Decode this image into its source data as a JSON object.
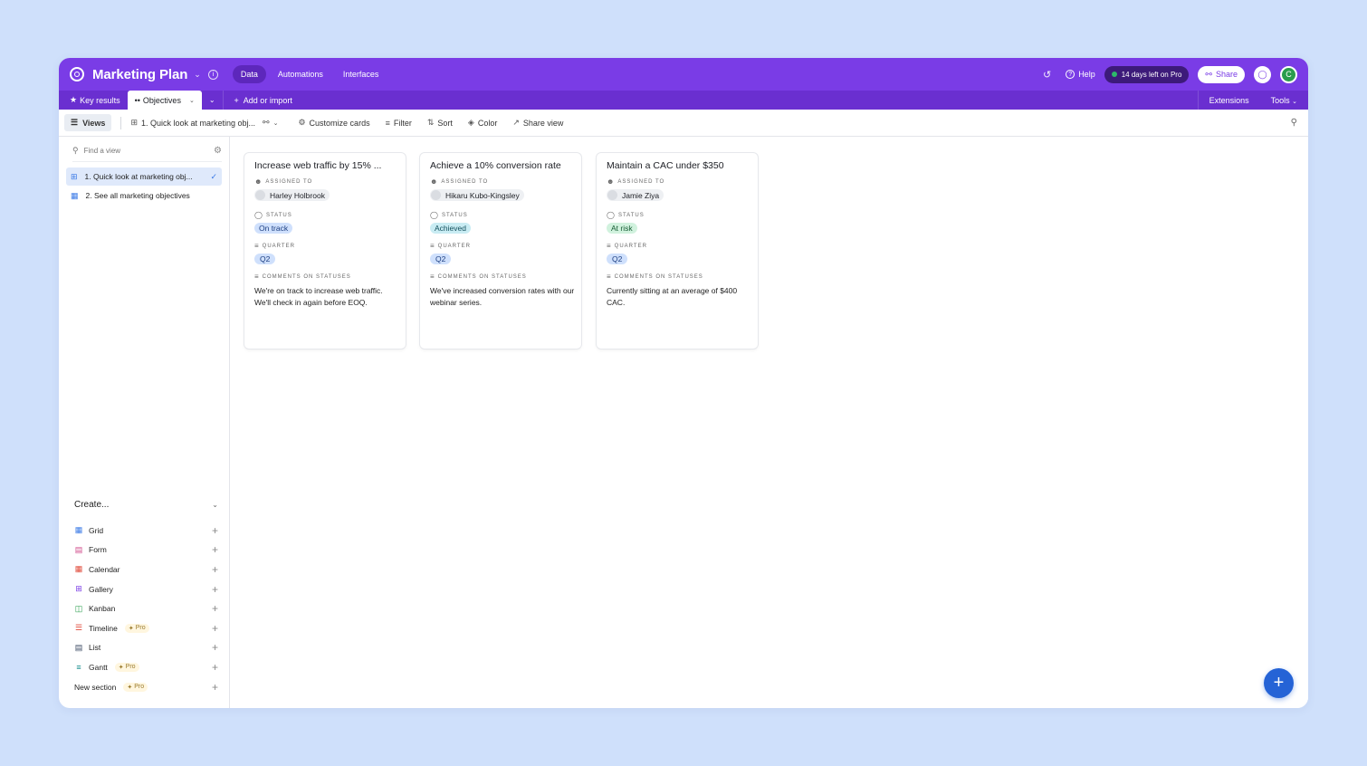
{
  "header": {
    "base_title": "Marketing Plan",
    "nav": [
      "Data",
      "Automations",
      "Interfaces"
    ],
    "help": "Help",
    "trial": "14 days left on Pro",
    "share": "Share",
    "avatar_initial": "C"
  },
  "tabs": {
    "key_results": "Key results",
    "objectives": "Objectives",
    "add_import": "Add or import",
    "extensions": "Extensions",
    "tools": "Tools"
  },
  "toolbar": {
    "views": "Views",
    "current_view": "1. Quick look at marketing obj...",
    "customize": "Customize cards",
    "filter": "Filter",
    "sort": "Sort",
    "color": "Color",
    "share_view": "Share view"
  },
  "sidebar": {
    "find_placeholder": "Find a view",
    "views": [
      {
        "label": "1. Quick look at marketing obj..."
      },
      {
        "label": "2. See all marketing objectives"
      }
    ],
    "create_label": "Create...",
    "create_items": [
      {
        "label": "Grid",
        "icon": "grid-icon"
      },
      {
        "label": "Form",
        "icon": "form-icon"
      },
      {
        "label": "Calendar",
        "icon": "calendar-icon"
      },
      {
        "label": "Gallery",
        "icon": "gallery-icon"
      },
      {
        "label": "Kanban",
        "icon": "kanban-icon"
      },
      {
        "label": "Timeline",
        "icon": "timeline-icon",
        "pro": "Pro"
      },
      {
        "label": "List",
        "icon": "list-icon"
      },
      {
        "label": "Gantt",
        "icon": "gantt-icon",
        "pro": "Pro"
      },
      {
        "label": "New section",
        "pro": "Pro"
      }
    ]
  },
  "field_labels": {
    "assigned": "ASSIGNED TO",
    "status": "STATUS",
    "quarter": "QUARTER",
    "comments": "COMMENTS ON STATUSES"
  },
  "cards": [
    {
      "title": "Increase web traffic by 15% ...",
      "assignee": "Harley Holbrook",
      "status": "On track",
      "quarter": "Q2",
      "comment": "We're on track to increase web traffic. We'll check in again before EOQ."
    },
    {
      "title": "Achieve a 10% conversion rate",
      "assignee": "Hikaru Kubo-Kingsley",
      "status": "Achieved",
      "quarter": "Q2",
      "comment": "We've increased conversion rates with our webinar series."
    },
    {
      "title": "Maintain a CAC under $350",
      "assignee": "Jamie Ziya",
      "status": "At risk",
      "quarter": "Q2",
      "comment": "Currently sitting at an average of $400 CAC."
    }
  ],
  "colors": {
    "header": "#7a3ce6",
    "tabbar": "#6a2fd0",
    "accent": "#2563d6",
    "background": "#cfe0fb"
  }
}
